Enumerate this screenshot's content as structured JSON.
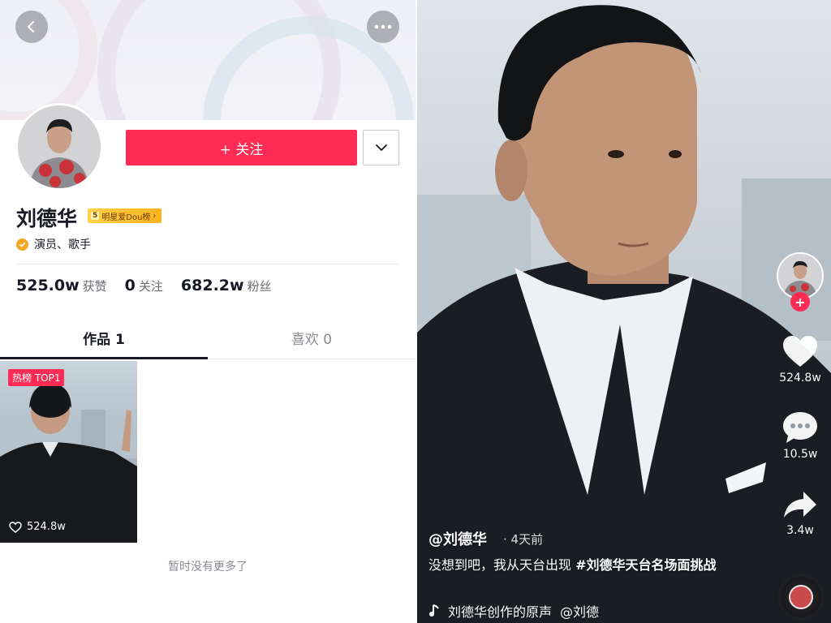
{
  "profile": {
    "name": "刘德华",
    "rank_number": "5",
    "rank_label": "明星爱Dou榜",
    "rank_arrow": "›",
    "verify_text": "演员、歌手",
    "follow_label": "+ 关注",
    "stats": [
      {
        "num": "525.0w",
        "label": "获赞"
      },
      {
        "num": "0",
        "label": "关注"
      },
      {
        "num": "682.2w",
        "label": "粉丝"
      }
    ],
    "tabs": {
      "works": "作品 1",
      "likes": "喜欢 0"
    },
    "video": {
      "badge": "热榜 TOP1",
      "likes": "524.8w"
    },
    "no_more": "暂时没有更多了"
  },
  "player": {
    "likes": "524.8w",
    "comments": "10.5w",
    "shares": "3.4w",
    "author": "@刘德华",
    "time": "· 4天前",
    "caption_text": "没想到吧，我从天台出现 ",
    "caption_tag": "#刘德华天台名场面挑战",
    "music_text": "刘德华创作的原声",
    "music_author": "@刘德"
  },
  "colors": {
    "accent": "#fe2c55",
    "text": "#161823",
    "muted": "#8a8b91",
    "verify": "#f5a623"
  }
}
